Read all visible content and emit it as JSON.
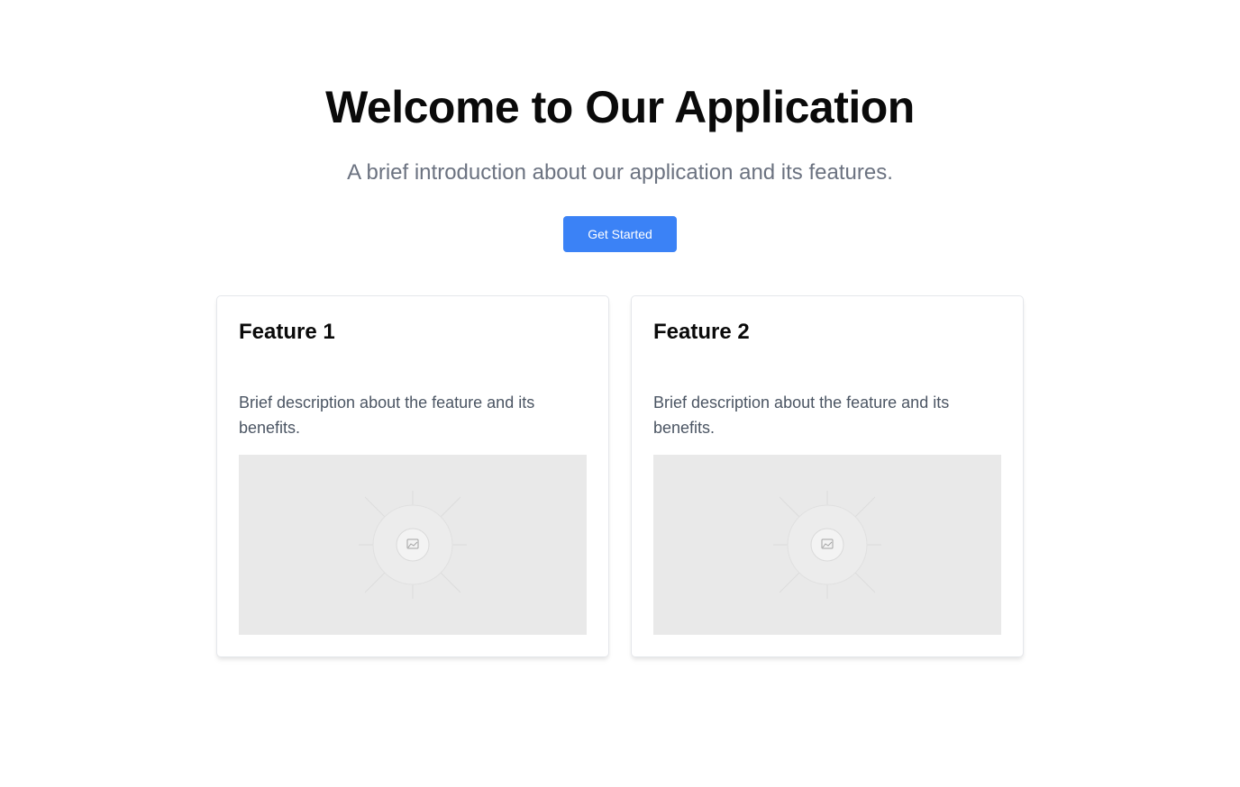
{
  "hero": {
    "title": "Welcome to Our Application",
    "subtitle": "A brief introduction about our application and its features.",
    "cta_label": "Get Started"
  },
  "colors": {
    "accent": "#3b82f6",
    "text_primary": "#0a0a0a",
    "text_muted": "#6b7280",
    "placeholder_bg": "#e9e9e9"
  },
  "features": [
    {
      "title": "Feature 1",
      "description": "Brief description about the feature and its benefits.",
      "image_icon": "image-placeholder-icon"
    },
    {
      "title": "Feature 2",
      "description": "Brief description about the feature and its benefits.",
      "image_icon": "image-placeholder-icon"
    }
  ]
}
